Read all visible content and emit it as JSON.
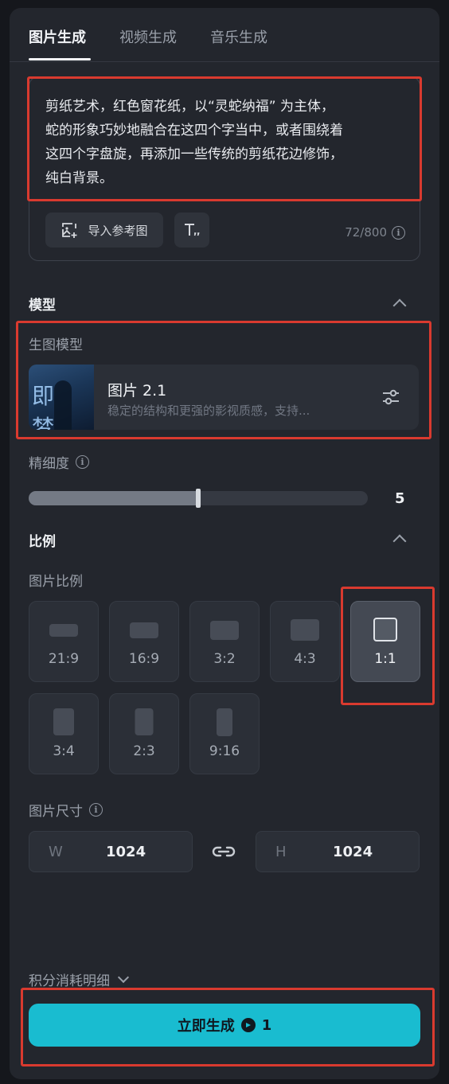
{
  "tabs": [
    {
      "label": "图片生成",
      "active": true
    },
    {
      "label": "视频生成",
      "active": false
    },
    {
      "label": "音乐生成",
      "active": false
    }
  ],
  "prompt": {
    "text": "剪纸艺术，红色窗花纸，以“灵蛇纳福” 为主体，\n蛇的形象巧妙地融合在这四个字当中，或者围绕着\n这四个字盘旋，再添加一些传统的剪纸花边修饰，\n纯白背景。",
    "import_ref_label": "导入参考图",
    "counter": "72/800"
  },
  "model_section": {
    "title": "模型",
    "sub_label": "生图模型",
    "model_name": "图片 2.1",
    "model_desc": "稳定的结构和更强的影视质感，支持...",
    "thumb_text": "即 梦"
  },
  "precision": {
    "label": "精细度",
    "value": "5",
    "fill_fraction": 0.5
  },
  "ratio_section": {
    "title": "比例",
    "sub_label": "图片比例",
    "ratios": [
      "21:9",
      "16:9",
      "3:2",
      "4:3",
      "1:1",
      "3:4",
      "2:3",
      "9:16"
    ],
    "selected": "1:1"
  },
  "size": {
    "label": "图片尺寸",
    "w_prefix": "W",
    "w_value": "1024",
    "h_prefix": "H",
    "h_value": "1024"
  },
  "credits_label": "积分消耗明细",
  "generate": {
    "label": "立即生成",
    "cost": "1"
  },
  "colors": {
    "accent": "#19bcd0",
    "highlight": "#d93a2f",
    "panel": "#23262d"
  }
}
